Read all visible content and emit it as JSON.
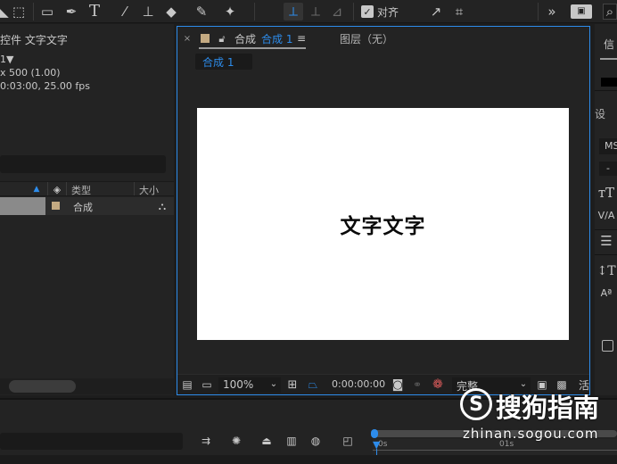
{
  "toolbar": {
    "align_label": "对齐"
  },
  "left_panel": {
    "title": "控件 文字文字",
    "comp_name": "1▼",
    "comp_size": "x 500 (1.00)",
    "comp_duration": "0:03:00, 25.00 fps",
    "columns": {
      "type": "类型",
      "size": "大小"
    },
    "rows": [
      {
        "type": "合成"
      }
    ]
  },
  "comp_panel": {
    "tab_prefix": "合成",
    "tab_active": "合成 1",
    "layer_tab": "图层（无）",
    "subtab": "合成 1",
    "canvas_text": "文字文字",
    "footer": {
      "zoom": "100%",
      "timecode": "0:00:00:00",
      "quality": "完整",
      "extra": "活"
    }
  },
  "right_panel": {
    "tab": "信",
    "label": "设",
    "font": "MS",
    "dash": "-"
  },
  "timeline": {
    "ruler_start": "0s",
    "ruler_mark": "01s"
  },
  "watermark": {
    "brand": "搜狗指南",
    "url": "zhinan.sogou.com"
  },
  "colors": {
    "accent": "#2d8ceb",
    "panel_bg": "#232323",
    "canvas_bg": "#ffffff",
    "label_swatch": "#c4aa82"
  }
}
